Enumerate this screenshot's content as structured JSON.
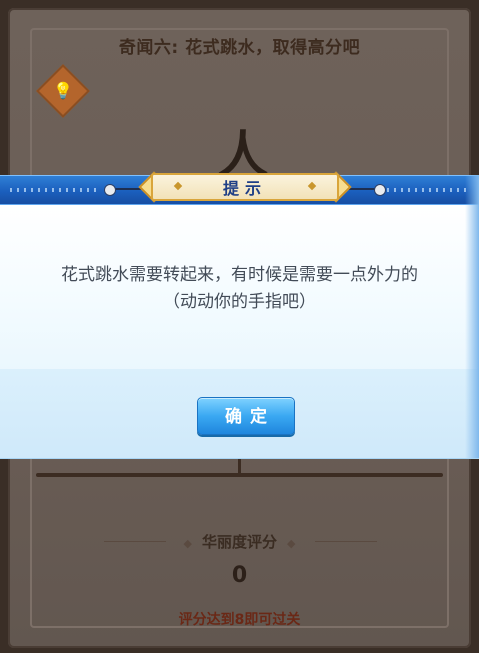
{
  "quest": {
    "title": "奇闻六: 花式跳水，取得高分吧",
    "hint_icon": "lightbulb-icon"
  },
  "dialog": {
    "title": "提示",
    "message_line1": "花式跳水需要转起来，有时候是需要一点外力的",
    "message_line2": "（动动你的手指吧）",
    "confirm_label": "确定"
  },
  "score": {
    "title": "华丽度评分",
    "value": "0",
    "pass_condition": "评分达到8即可过关"
  },
  "colors": {
    "dialog_header": "#1b5fbd",
    "button": "#3aa8f2",
    "pass_text": "#6a2816"
  }
}
